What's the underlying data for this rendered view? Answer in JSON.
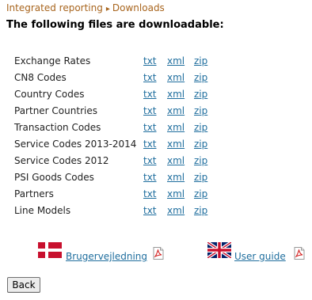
{
  "breadcrumb": {
    "parent": "Integrated reporting",
    "separator": "▸",
    "current": "Downloads"
  },
  "title": "The following files are downloadable:",
  "files": [
    {
      "name": "Exchange Rates",
      "txt": "txt",
      "xml": "xml",
      "zip": "zip"
    },
    {
      "name": "CN8 Codes",
      "txt": "txt",
      "xml": "xml",
      "zip": "zip"
    },
    {
      "name": "Country Codes",
      "txt": "txt",
      "xml": "xml",
      "zip": "zip"
    },
    {
      "name": "Partner Countries",
      "txt": "txt",
      "xml": "xml",
      "zip": "zip"
    },
    {
      "name": "Transaction Codes",
      "txt": "txt",
      "xml": "xml",
      "zip": "zip"
    },
    {
      "name": "Service Codes 2013-2014",
      "txt": "txt",
      "xml": "xml",
      "zip": "zip"
    },
    {
      "name": "Service Codes 2012",
      "txt": "txt",
      "xml": "xml",
      "zip": "zip"
    },
    {
      "name": "PSI Goods Codes",
      "txt": "txt",
      "xml": "xml",
      "zip": "zip"
    },
    {
      "name": "Partners",
      "txt": "txt",
      "xml": "xml",
      "zip": "zip"
    },
    {
      "name": "Line Models",
      "txt": "txt",
      "xml": "xml",
      "zip": "zip"
    }
  ],
  "manuals": {
    "danish": {
      "label": "Brugervejledning",
      "flag_icon": "danish-flag-icon",
      "doc_icon": "pdf-icon"
    },
    "english": {
      "label": "User guide",
      "flag_icon": "uk-flag-icon",
      "doc_icon": "pdf-icon"
    }
  },
  "back_button": "Back",
  "colors": {
    "breadcrumb": "#a8651e",
    "link": "#1f6e9e",
    "pdf_red": "#d32020"
  }
}
